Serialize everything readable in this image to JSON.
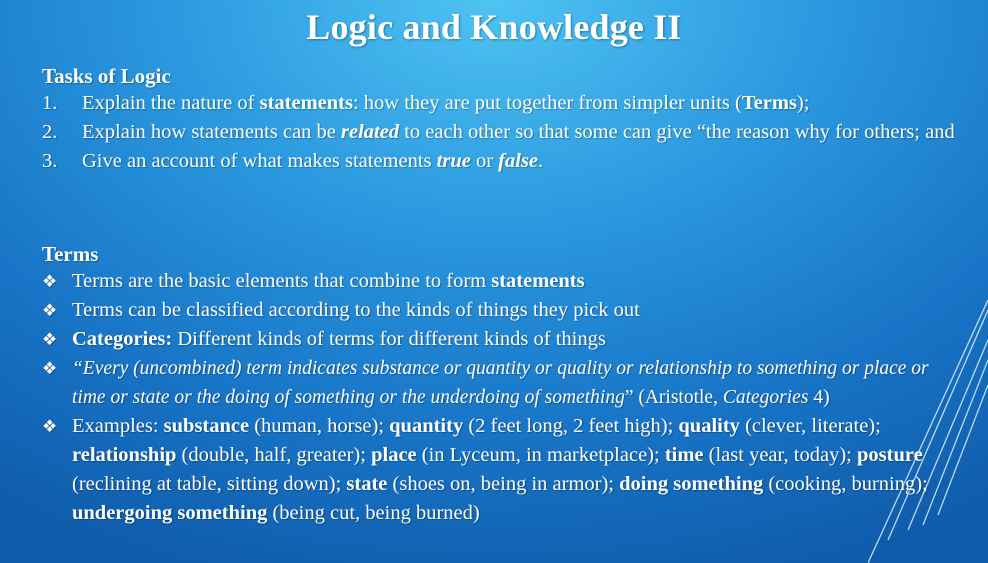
{
  "slide": {
    "title": "Logic and Knowledge II"
  },
  "tasks": {
    "heading": "Tasks of Logic",
    "items": [
      {
        "num": "1.",
        "parts": [
          "Explain the nature of ",
          "statements",
          ": how they are put together from simpler units (",
          "Terms",
          ");"
        ]
      },
      {
        "num": "2.",
        "parts": [
          "Explain how statements can be ",
          "related",
          " to each other so that some can give “the reason why for others; and"
        ]
      },
      {
        "num": "3.",
        "parts": [
          "Give an account of what makes statements ",
          "true",
          " or ",
          "false",
          "."
        ]
      }
    ]
  },
  "terms": {
    "heading": "Terms",
    "bullet_glyph": "❖",
    "items": [
      {
        "parts": [
          "Terms are the basic elements that combine to form ",
          "statements"
        ]
      },
      {
        "parts": [
          "Terms can be classified according to the kinds of things they pick out"
        ]
      },
      {
        "parts": [
          "Categories:",
          " Different kinds of terms for different kinds of things"
        ]
      },
      {
        "parts": [
          "“Every (uncombined) term indicates substance or quantity or quality or relationship to something or place or time or state or the doing of something or the underdoing of something",
          "” (Aristotle, ",
          "Categories",
          " 4)"
        ]
      },
      {
        "parts": [
          "Examples: ",
          "substance",
          " (human, horse); ",
          "quantity",
          " (2 feet long, 2 feet high); ",
          "quality",
          " (clever, literate); ",
          "relationship",
          " (double, half, greater); ",
          "place",
          " (in Lyceum, in marketplace); ",
          "time",
          " (last year, today); ",
          "posture",
          " (reclining at table, sitting down); ",
          "state",
          " (shoes on, being in armor); ",
          "doing something",
          " (cooking, burning); ",
          "undergoing something",
          " (being cut, being burned)"
        ]
      }
    ]
  },
  "colors": {
    "text": "#ffffff",
    "background_top": "#4fc3f2",
    "background_bottom": "#0f5aa9"
  }
}
